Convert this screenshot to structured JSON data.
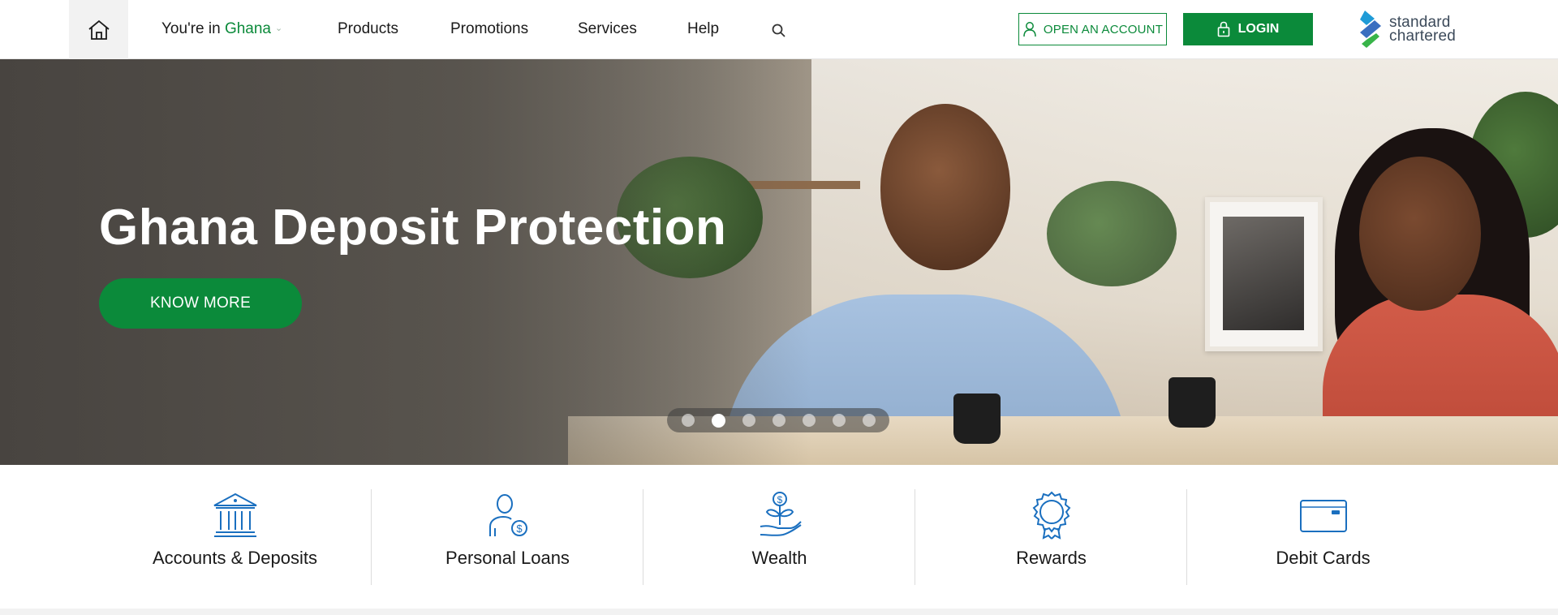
{
  "header": {
    "home_icon": "home-icon",
    "country_prefix": "You're in",
    "country_name": "Ghana",
    "nav": [
      "Products",
      "Promotions",
      "Services",
      "Help"
    ],
    "search_icon": "search-icon",
    "open_account_label": "OPEN AN ACCOUNT",
    "login_label": "LOGIN",
    "logo_line1": "standard",
    "logo_line2": "chartered",
    "accent_color": "#0b8a3a"
  },
  "hero": {
    "title": "Ghana Deposit Protection",
    "cta_label": "KNOW MORE",
    "slide_count": 7,
    "active_slide": 2
  },
  "categories": [
    {
      "label": "Accounts & Deposits",
      "icon": "bank-icon"
    },
    {
      "label": "Personal Loans",
      "icon": "person-dollar-icon"
    },
    {
      "label": "Wealth",
      "icon": "plant-coin-icon"
    },
    {
      "label": "Rewards",
      "icon": "award-badge-icon"
    },
    {
      "label": "Debit Cards",
      "icon": "debit-card-icon"
    }
  ],
  "icon_color": "#1a6fbf"
}
